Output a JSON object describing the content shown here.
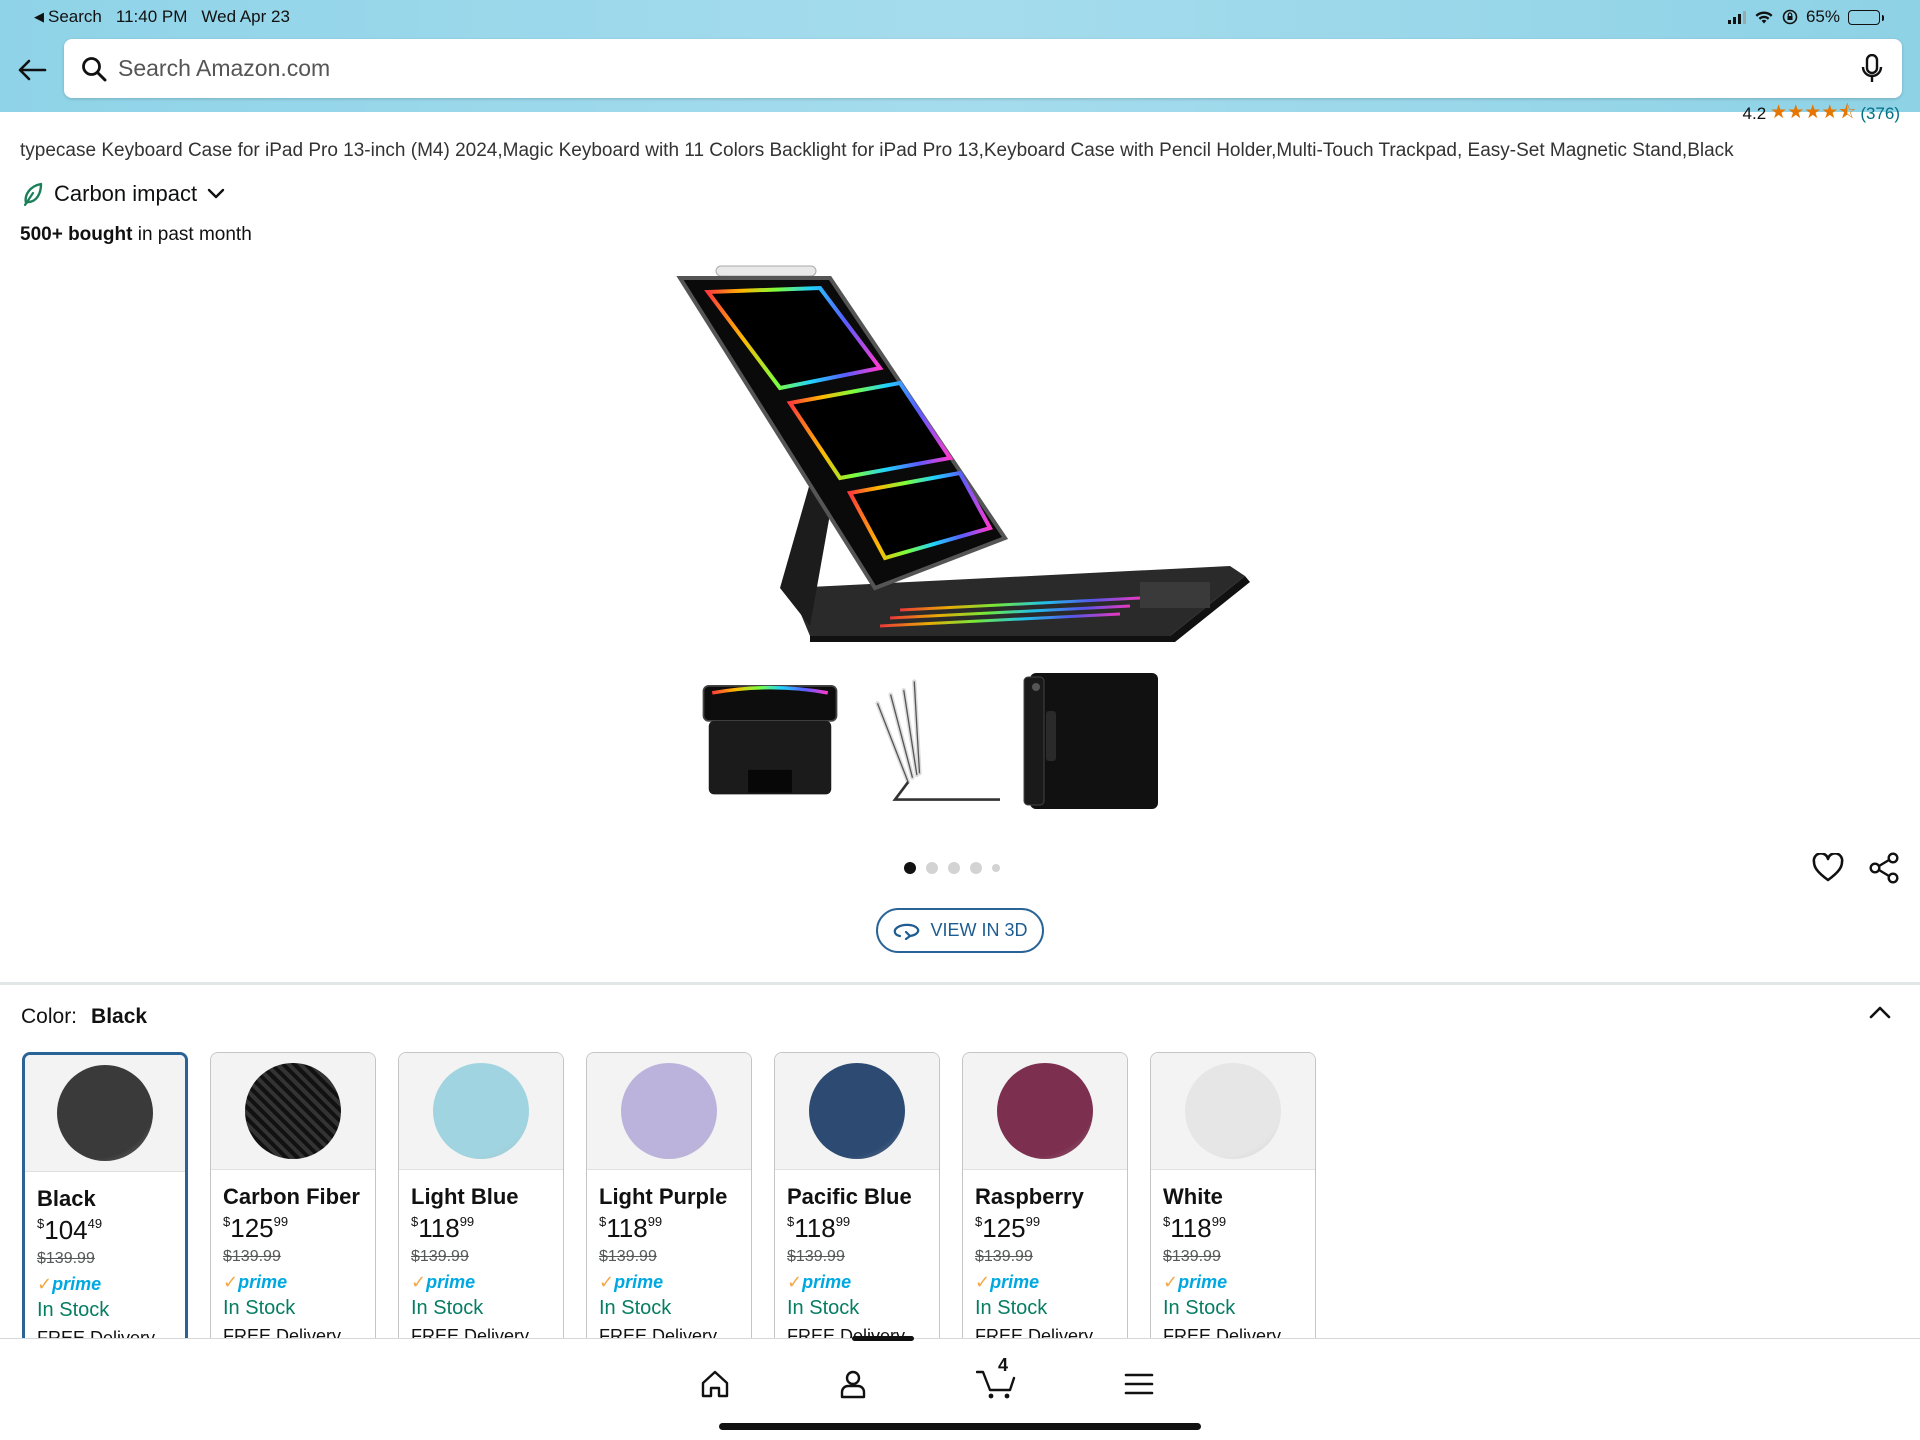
{
  "status_bar": {
    "back_app": "Search",
    "time": "11:40 PM",
    "date": "Wed Apr 23",
    "battery": "65%",
    "battery_level": 0.65
  },
  "search": {
    "placeholder": "Search Amazon.com"
  },
  "rating": {
    "value": "4.2",
    "stars": "★★★★⯪",
    "count": "(376)"
  },
  "product": {
    "title": "typecase Keyboard Case for iPad Pro 13-inch (M4) 2024,Magic Keyboard with 11 Colors Backlight for iPad Pro 13,Keyboard Case with Pencil Holder,Multi-Touch Trackpad, Easy-Set Magnetic Stand,Black",
    "carbon_label": "Carbon impact",
    "bought_bold": "500+ bought",
    "bought_rest": " in past month",
    "view3d_label": "VIEW IN 3D",
    "image_count": 5,
    "active_image": 1
  },
  "color": {
    "label": "Color:",
    "selected": "Black",
    "options": [
      {
        "name": "Black",
        "dollars": "104",
        "cents": "49",
        "list": "$139.99",
        "stock": "In Stock",
        "delivery": "FREE Delivery",
        "color": "#3a3a3a"
      },
      {
        "name": "Carbon Fiber",
        "dollars": "125",
        "cents": "99",
        "list": "$139.99",
        "stock": "In Stock",
        "delivery": "FREE Delivery",
        "color": "#1e1e1e"
      },
      {
        "name": "Light Blue",
        "dollars": "118",
        "cents": "99",
        "list": "$139.99",
        "stock": "In Stock",
        "delivery": "FREE Delivery",
        "color": "#9fd4e0"
      },
      {
        "name": "Light Purple",
        "dollars": "118",
        "cents": "99",
        "list": "$139.99",
        "stock": "In Stock",
        "delivery": "FREE Delivery",
        "color": "#bcb3dc"
      },
      {
        "name": "Pacific Blue",
        "dollars": "118",
        "cents": "99",
        "list": "$139.99",
        "stock": "In Stock",
        "delivery": "FREE Delivery",
        "color": "#2c4a72"
      },
      {
        "name": "Raspberry",
        "dollars": "125",
        "cents": "99",
        "list": "$139.99",
        "stock": "In Stock",
        "delivery": "FREE Delivery",
        "color": "#7c2f4f"
      },
      {
        "name": "White",
        "dollars": "118",
        "cents": "99",
        "list": "$139.99",
        "stock": "In Stock",
        "delivery": "FREE Delivery",
        "color": "#e6e6e6"
      }
    ]
  },
  "prime": {
    "check": "✓",
    "label": "prime"
  },
  "nav": {
    "cart_count": "4"
  },
  "colors": {
    "header_bg": "#a5dced",
    "link": "#007185",
    "stock_green": "#067d62",
    "selected_border": "#2a6496",
    "star_orange": "#e77600"
  }
}
